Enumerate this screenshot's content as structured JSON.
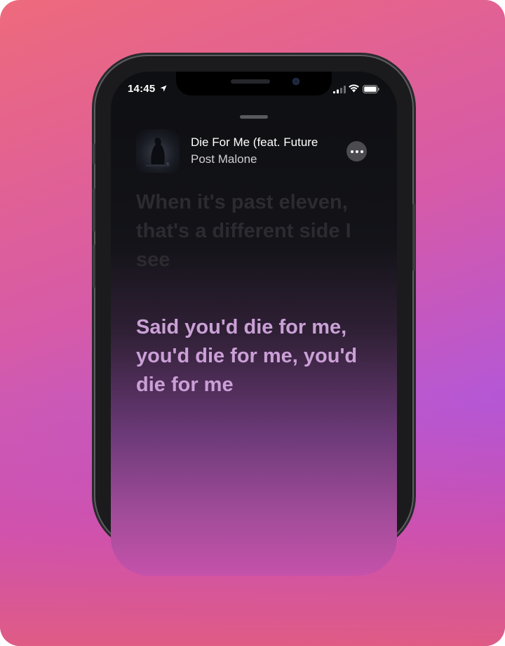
{
  "status_bar": {
    "time": "14:45"
  },
  "now_playing": {
    "title": "Die For Me (feat. Future",
    "artist": "Post Malone"
  },
  "lyrics": {
    "previous": "When it's past eleven, that's a different side I see",
    "current": "Said you'd die for me, you'd die for me, you'd die for me",
    "next": ""
  }
}
